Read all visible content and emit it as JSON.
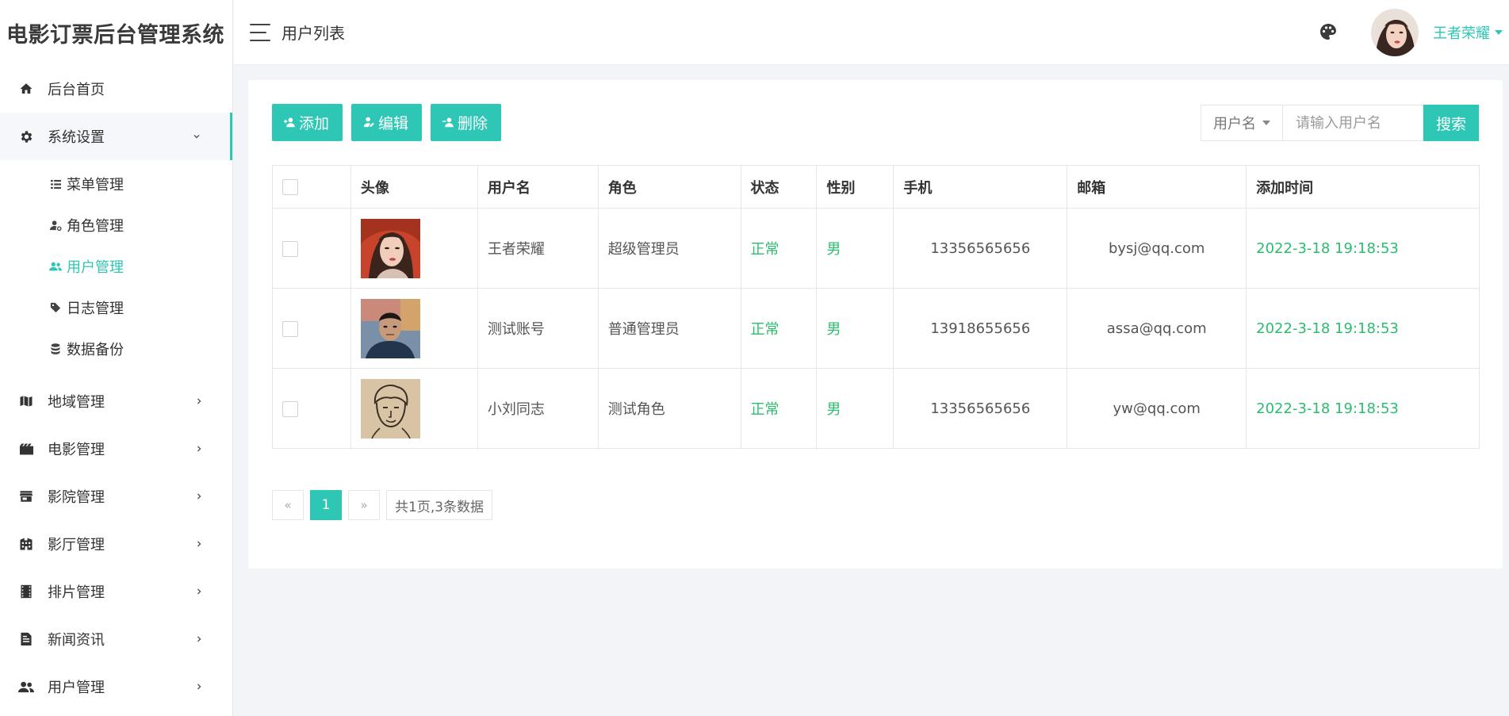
{
  "app": {
    "title": "电影订票后台管理系统"
  },
  "header": {
    "page_title": "用户列表",
    "username": "王者荣耀"
  },
  "sidebar": {
    "items": [
      {
        "label": "后台首页",
        "icon": "home-icon"
      },
      {
        "label": "系统设置",
        "icon": "gear-icon",
        "open": true,
        "children": [
          {
            "label": "菜单管理",
            "icon": "list-icon"
          },
          {
            "label": "角色管理",
            "icon": "user-settings-icon"
          },
          {
            "label": "用户管理",
            "icon": "users-icon",
            "active": true
          },
          {
            "label": "日志管理",
            "icon": "tag-icon"
          },
          {
            "label": "数据备份",
            "icon": "database-icon"
          }
        ]
      },
      {
        "label": "地域管理",
        "icon": "map-icon"
      },
      {
        "label": "电影管理",
        "icon": "film-icon"
      },
      {
        "label": "影院管理",
        "icon": "store-icon"
      },
      {
        "label": "影厅管理",
        "icon": "building-icon"
      },
      {
        "label": "排片管理",
        "icon": "film-strip-icon"
      },
      {
        "label": "新闻资讯",
        "icon": "article-icon"
      },
      {
        "label": "用户管理",
        "icon": "people-icon"
      }
    ]
  },
  "toolbar": {
    "add_label": "添加",
    "edit_label": "编辑",
    "delete_label": "删除"
  },
  "search": {
    "field_label": "用户名",
    "placeholder": "请输入用户名",
    "button_label": "搜索"
  },
  "table": {
    "headers": [
      "头像",
      "用户名",
      "角色",
      "状态",
      "性别",
      "手机",
      "邮箱",
      "添加时间"
    ],
    "rows": [
      {
        "username": "王者荣耀",
        "role": "超级管理员",
        "status": "正常",
        "gender": "男",
        "phone": "13356565656",
        "email": "bysj@qq.com",
        "created": "2022-3-18 19:18:53"
      },
      {
        "username": "测试账号",
        "role": "普通管理员",
        "status": "正常",
        "gender": "男",
        "phone": "13918655656",
        "email": "assa@qq.com",
        "created": "2022-3-18 19:18:53"
      },
      {
        "username": "小刘同志",
        "role": "测试角色",
        "status": "正常",
        "gender": "男",
        "phone": "13356565656",
        "email": "yw@qq.com",
        "created": "2022-3-18 19:18:53"
      }
    ]
  },
  "pagination": {
    "prev": "«",
    "current": "1",
    "next": "»",
    "summary": "共1页,3条数据"
  },
  "colors": {
    "accent": "#2ec7b6",
    "status_green": "#2bbd6e"
  }
}
